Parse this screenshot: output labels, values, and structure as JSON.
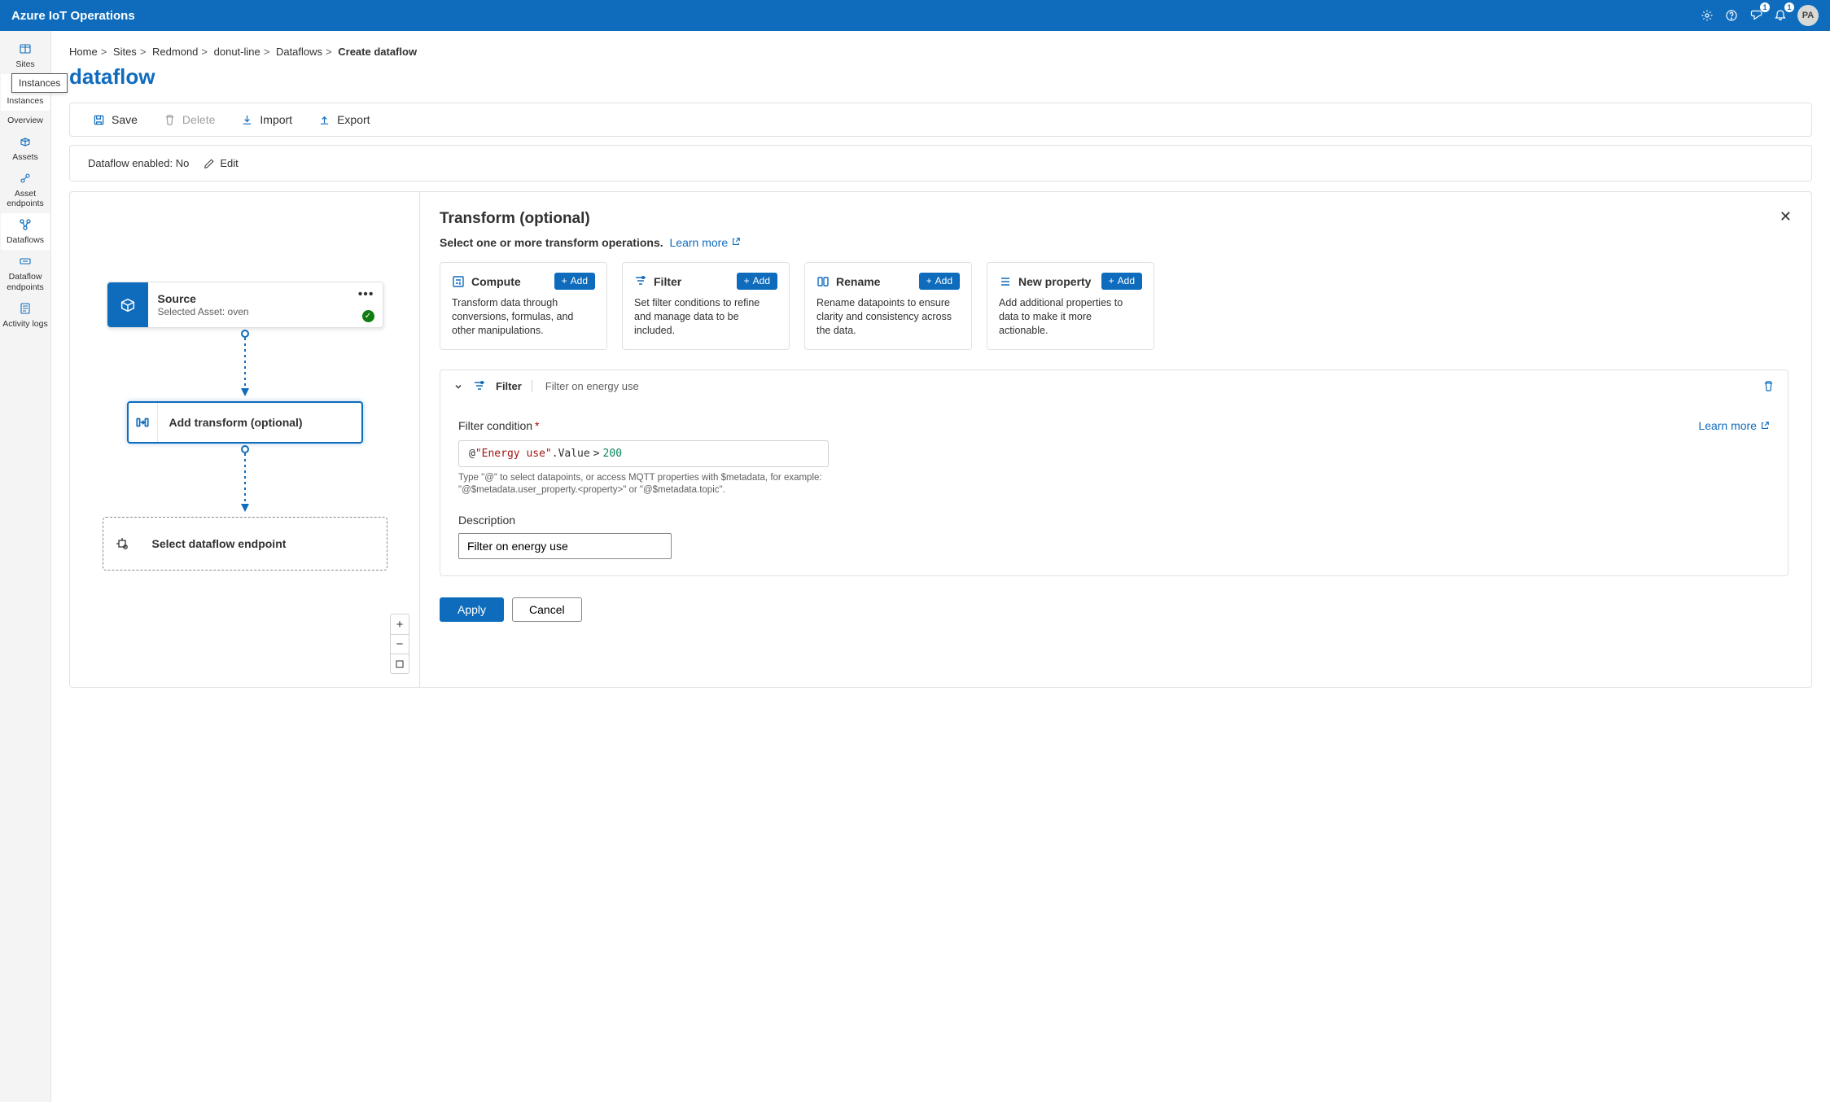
{
  "header": {
    "product": "Azure IoT Operations",
    "avatar": "PA",
    "badge_feedback": "1",
    "badge_bell": "1"
  },
  "nav": {
    "items": [
      {
        "label": "Sites"
      },
      {
        "label": "Instances"
      },
      {
        "label": "Overview"
      },
      {
        "label": "Assets"
      },
      {
        "label": "Asset endpoints"
      },
      {
        "label": "Dataflows"
      },
      {
        "label": "Dataflow endpoints"
      },
      {
        "label": "Activity logs"
      }
    ],
    "tooltip": "Instances"
  },
  "breadcrumb": {
    "items": [
      "Home",
      "Sites",
      "Redmond",
      "donut-line",
      "Dataflows"
    ],
    "current": "Create dataflow"
  },
  "page": {
    "title": "dataflow"
  },
  "toolbar": {
    "save": "Save",
    "delete": "Delete",
    "import": "Import",
    "export": "Export"
  },
  "status": {
    "label": "Dataflow enabled:",
    "value": "No",
    "edit": "Edit"
  },
  "canvas": {
    "source": {
      "title": "Source",
      "subtitle": "Selected Asset: oven"
    },
    "transform": {
      "label": "Add transform (optional)"
    },
    "endpoint": {
      "label": "Select dataflow endpoint"
    }
  },
  "panel": {
    "title": "Transform (optional)",
    "subtitle": "Select one or more transform operations.",
    "learn_more": "Learn more",
    "cards": {
      "compute": {
        "name": "Compute",
        "desc": "Transform data through conversions, formulas, and other manipulations.",
        "add": "Add"
      },
      "filter": {
        "name": "Filter",
        "desc": "Set filter conditions to refine and manage data to be included.",
        "add": "Add"
      },
      "rename": {
        "name": "Rename",
        "desc": "Rename datapoints to ensure clarity and consistency across the data.",
        "add": "Add"
      },
      "newprop": {
        "name": "New property",
        "desc": "Add additional properties to data to make it more actionable.",
        "add": "Add"
      }
    },
    "filter_block": {
      "head_title": "Filter",
      "head_sub": "Filter on energy use",
      "condition_label": "Filter condition",
      "learn_more": "Learn more",
      "code": {
        "at": "@",
        "str": "\"Energy use\"",
        "dot": ".Value",
        "op": ">",
        "num": "200"
      },
      "hint": "Type \"@\" to select datapoints, or access MQTT properties with $metadata, for example: \"@$metadata.user_property.<property>\" or \"@$metadata.topic\".",
      "desc_label": "Description",
      "desc_value": "Filter on energy use"
    },
    "buttons": {
      "apply": "Apply",
      "cancel": "Cancel"
    }
  }
}
